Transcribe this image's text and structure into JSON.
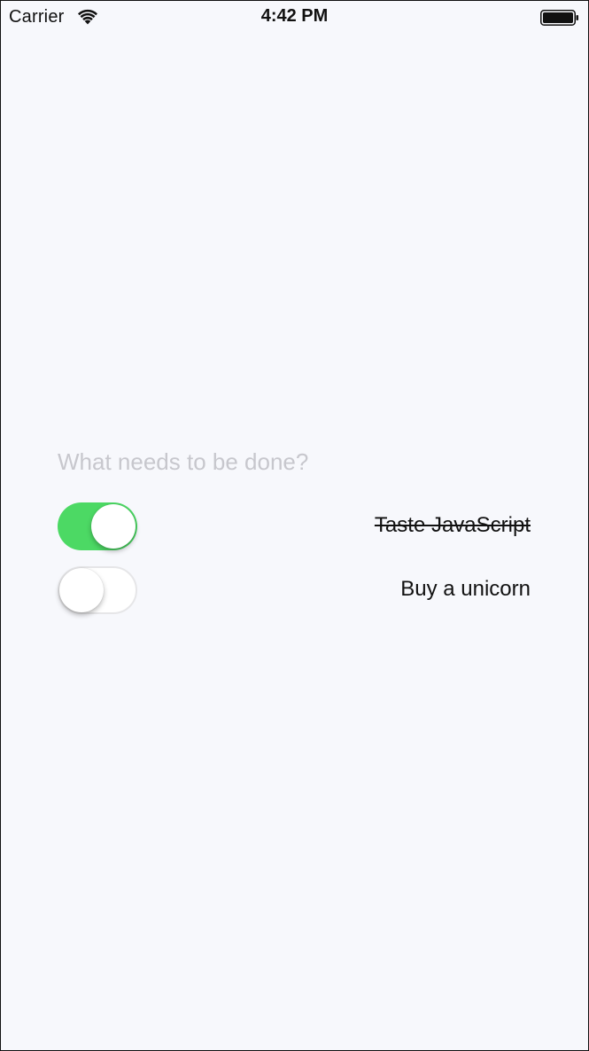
{
  "status_bar": {
    "carrier": "Carrier",
    "time": "4:42 PM",
    "wifi_icon": "wifi-icon",
    "battery_icon": "battery-icon"
  },
  "new_todo": {
    "placeholder": "What needs to be done?",
    "value": ""
  },
  "todos": [
    {
      "text": "Taste JavaScript",
      "completed": true
    },
    {
      "text": "Buy a unicorn",
      "completed": false
    }
  ],
  "colors": {
    "toggle_on": "#4cd964",
    "background": "#f7f8fc",
    "placeholder": "#c7c7cd"
  }
}
